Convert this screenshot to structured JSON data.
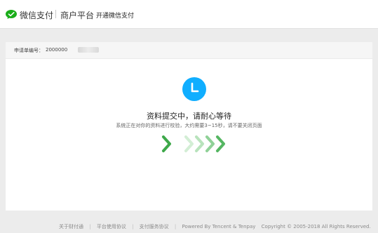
{
  "header": {
    "brand": "微信支付",
    "platform": "商户平台",
    "open_link": "开通微信支付"
  },
  "order": {
    "label": "申请单编号：",
    "value": "2000000"
  },
  "status": {
    "title": "资料提交中，请耐心等待",
    "description": "系统正在对你的资料进行校验，大约需要3~15秒，请不要关闭页面"
  },
  "footer": {
    "links": [
      "关于财付通",
      "平台使用协议",
      "支付服务协议"
    ],
    "powered": "Powered By Tencent & Tenpay",
    "copyright": "Copyright © 2005-2018 All Rights Reserved."
  },
  "colors": {
    "wechat_green": "#1aad19",
    "clock_blue": "#10aeff",
    "arrow_dark": "#3ea84a",
    "arrow_light": "#a9dcae"
  }
}
